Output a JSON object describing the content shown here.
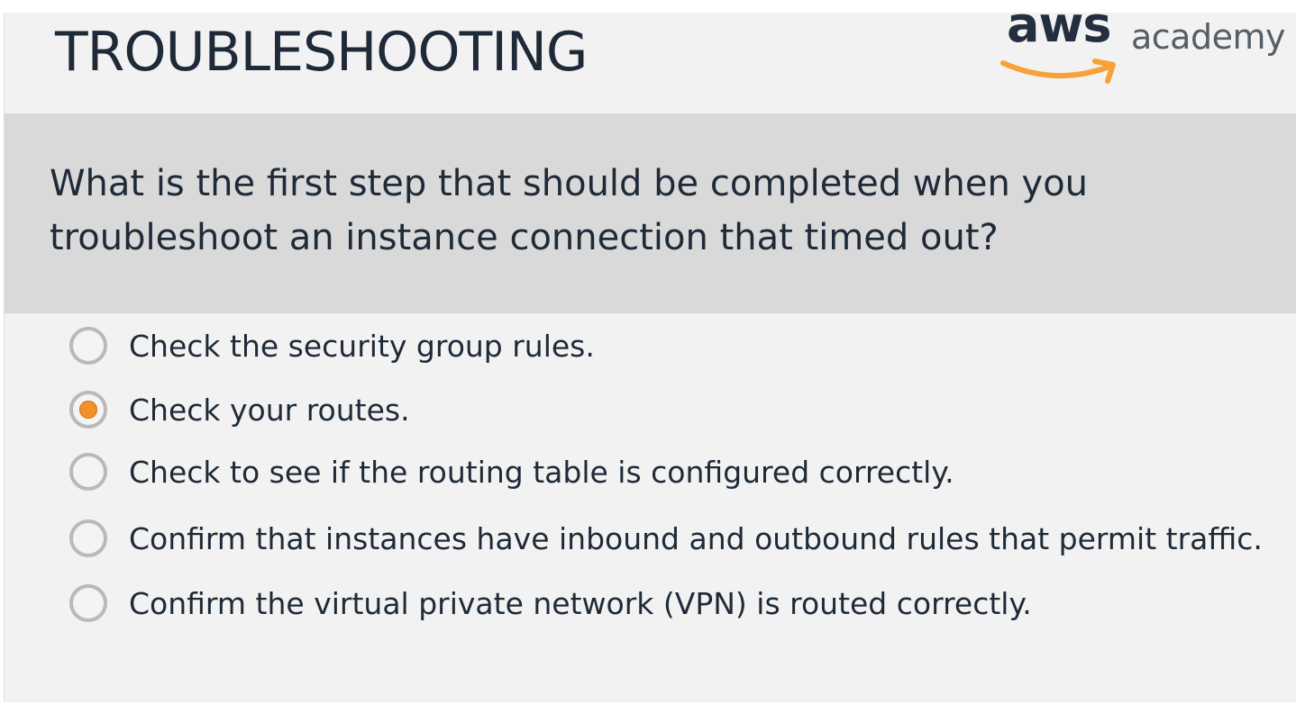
{
  "header": {
    "title": "TROUBLESHOOTING",
    "logo": {
      "wordmark": "aws",
      "suffix": "academy",
      "smile_color": "#f7a138"
    }
  },
  "question": {
    "text": "What is the first step that should be completed when you troubleshoot an instance connection that timed out?"
  },
  "options": [
    {
      "label": "Check the security group rules.",
      "selected": false
    },
    {
      "label": "Check your routes.",
      "selected": true
    },
    {
      "label": "Check to see if the routing table is configured correctly.",
      "selected": false
    },
    {
      "label": "Confirm that instances have inbound and outbound rules that permit traffic.",
      "selected": false
    },
    {
      "label": "Confirm the virtual private network (VPN) is routed correctly.",
      "selected": false
    }
  ],
  "colors": {
    "accent": "#f0912c",
    "text": "#1e2a38",
    "band": "#d9d9d9",
    "background": "#f2f2f2"
  }
}
